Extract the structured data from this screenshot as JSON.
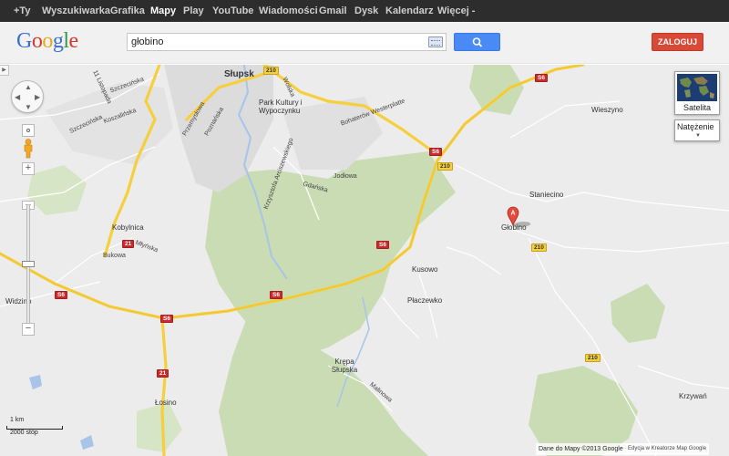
{
  "topbar": {
    "items": [
      "+Ty",
      "Wyszukiwarka",
      "Grafika",
      "Mapy",
      "Play",
      "YouTube",
      "Wiadomości",
      "Gmail",
      "Dysk",
      "Kalendarz",
      "Więcej -"
    ],
    "active": "Mapy"
  },
  "header": {
    "logo": "Google",
    "search_value": "głobino",
    "search_icon": "magnifier-icon",
    "keyboard_icon": "keyboard-icon",
    "login_label": "ZALOGUJ"
  },
  "map": {
    "controls": {
      "pan_icon": "pan-arrows-icon",
      "zoom_in": "+",
      "zoom_out": "−",
      "pegman_icon": "pegman-icon",
      "satellite_label": "Satelita",
      "traffic_label": "Natężenie",
      "collapse_icon": "left-arrow-icon"
    },
    "labels": {
      "slupsk": "Słupsk",
      "park": "Park Kultury i Wypoczynku",
      "l11listopada": "11 Listopada",
      "szczecinska": "Szczecińska",
      "szczecinska2": "Szczecińska",
      "koszalinska": "Koszalińska",
      "poznanska": "Poznańska",
      "przemyslowa": "Przemysłowa",
      "wolska": "Wolska",
      "bohaterow": "Bohaterów Westerplatte",
      "krzysztofa": "Krzysztofa Arciszewskiego",
      "jodlowa": "Jodłowa",
      "gdanska": "Gdańska",
      "wieszyno": "Wieszyno",
      "staniecino": "Staniecino",
      "globino": "Głobino",
      "kusowo": "Kusowo",
      "placzewko": "Płaczewko",
      "kobylnica": "Kobylnica",
      "bukowa": "Bukowa",
      "mylnska": "Młyńska",
      "widzino": "Widzino",
      "krepa": "Krępa Słupska",
      "mallowa": "Malinowa",
      "losino": "Łosino",
      "krzywan": "Krzywań"
    },
    "shields": {
      "r210a": "210",
      "r210b": "210",
      "r210c": "210",
      "r210d": "210",
      "s6a": "S6",
      "s6b": "S6",
      "s6c": "S6",
      "s6d": "S6",
      "s6e": "S6",
      "s6f": "S6",
      "s6g": "S6",
      "r21a": "21",
      "r21b": "21"
    },
    "marker": "A",
    "marker_icon": "map-pin-icon",
    "scale": {
      "km": "1 km",
      "ft": "2000 stóp"
    },
    "footer": {
      "copyright": "Dane do Mapy ©2013 Google -",
      "edit": "Edycja w Kreatorze Map Google"
    }
  },
  "colors": {
    "topbar_bg": "#2d2d2d",
    "search_blue": "#4a8af4",
    "login_red": "#d84a38",
    "forest": "#c9dcb4",
    "highway": "#f5cf3c",
    "water": "#a8c4e8"
  }
}
